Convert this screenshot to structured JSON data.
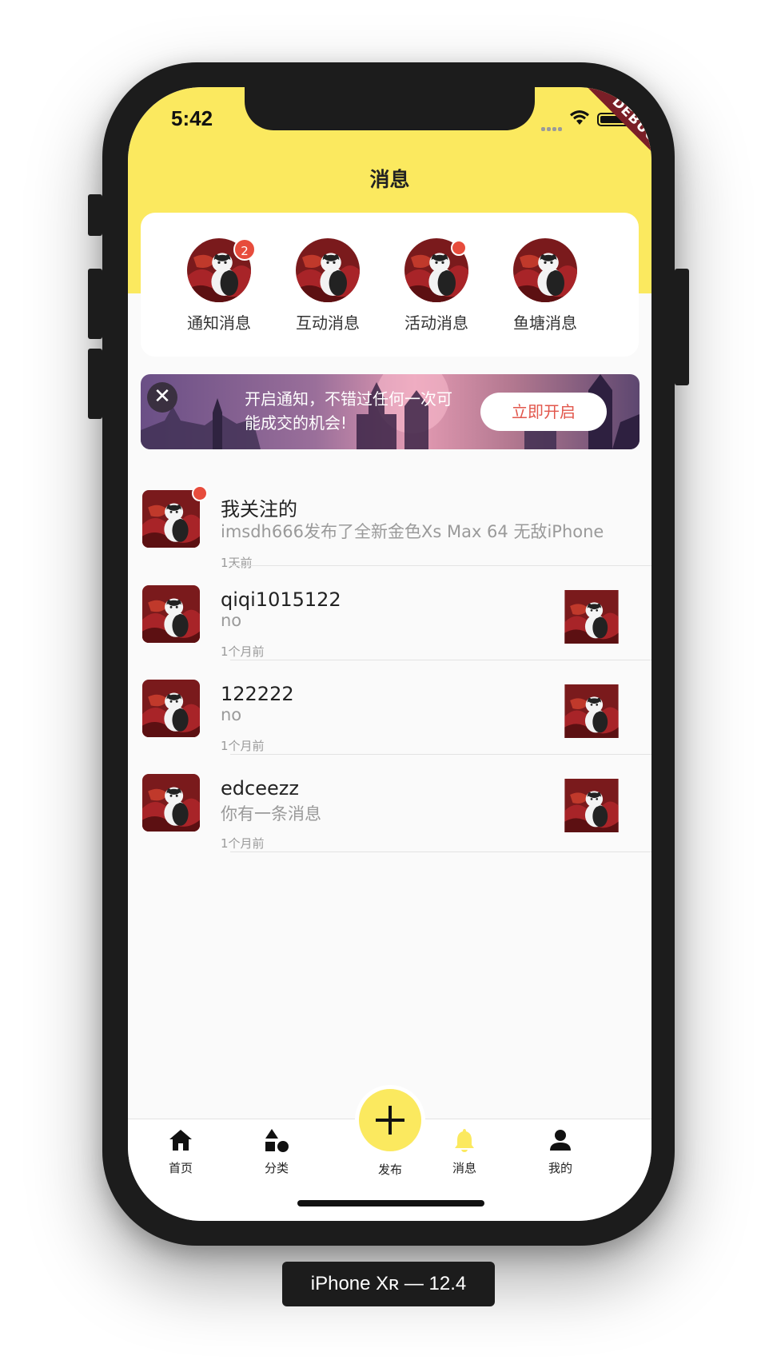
{
  "status_bar": {
    "time": "5:42",
    "debug_banner": "DEBUG"
  },
  "header": {
    "title": "消息"
  },
  "categories": [
    {
      "label": "通知消息",
      "badge": "2"
    },
    {
      "label": "互动消息",
      "badge": ""
    },
    {
      "label": "活动消息",
      "badge": "dot"
    },
    {
      "label": "鱼塘消息",
      "badge": ""
    }
  ],
  "banner": {
    "text": "开启通知，不错过任何一次可能成交的机会!",
    "button_label": "立即开启",
    "close_icon": "close-icon"
  },
  "messages": [
    {
      "name": "我关注的",
      "text": "imsdh666发布了全新金色Xs Max 64 无敌iPhone",
      "time": "1天前",
      "unread": true,
      "has_thumb": false
    },
    {
      "name": "qiqi1015122",
      "text": "no",
      "time": "1个月前",
      "unread": false,
      "has_thumb": true
    },
    {
      "name": "122222",
      "text": "no",
      "time": "1个月前",
      "unread": false,
      "has_thumb": true
    },
    {
      "name": "edceezz",
      "text": "你有一条消息",
      "time": "1个月前",
      "unread": false,
      "has_thumb": true
    }
  ],
  "tabbar": {
    "home": "首页",
    "category": "分类",
    "publish": "发布",
    "messages": "消息",
    "mine": "我的",
    "active": "messages"
  },
  "device_label": "iPhone Xʀ — 12.4",
  "colors": {
    "primary_yellow": "#fbe95f",
    "badge_red": "#e74c3c",
    "button_text_red": "#e2574c",
    "active_tab": "#fbe95f"
  }
}
